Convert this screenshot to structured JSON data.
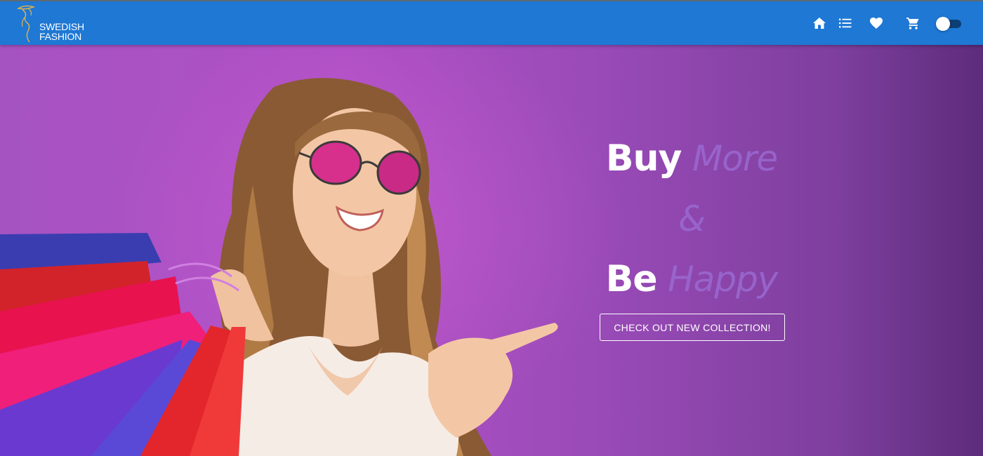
{
  "brand": {
    "line1": "SWEDISH",
    "line2": "FASHION"
  },
  "nav": {
    "icons": [
      "home-icon",
      "list-icon",
      "heart-icon",
      "cart-icon"
    ],
    "theme_toggle": {
      "checked": false
    }
  },
  "hero": {
    "line1": {
      "bold": "Buy",
      "light": "More"
    },
    "line2": {
      "light": "&"
    },
    "line3": {
      "bold": "Be",
      "light": "Happy"
    },
    "cta_label": "CHECK OUT NEW COLLECTION!"
  },
  "colors": {
    "appbar": "#1e78d4",
    "hero_bg": "#a653c2",
    "accent_text": "#9c6fd6",
    "logo_gold": "#e3b24a"
  }
}
